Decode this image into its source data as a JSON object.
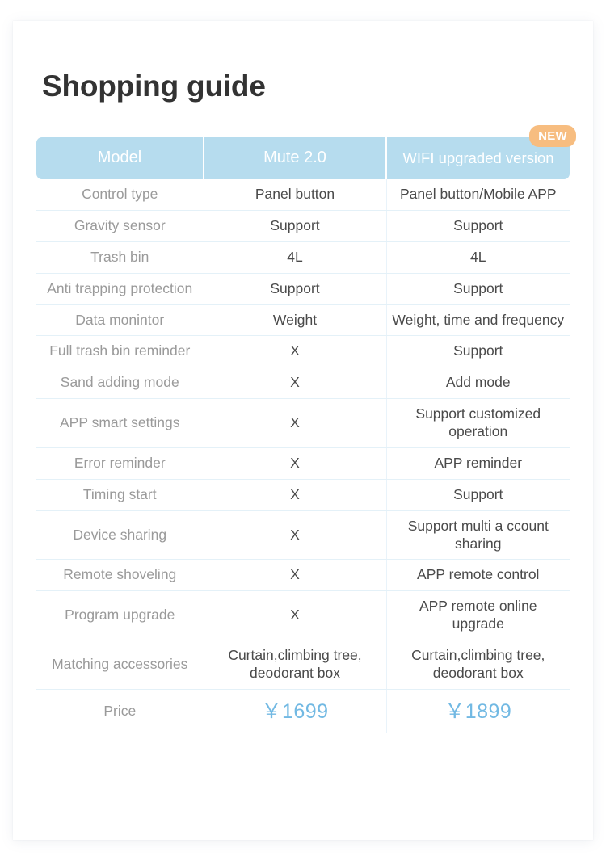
{
  "page": {
    "title": "Shopping guide"
  },
  "badge": {
    "new_label": "NEW"
  },
  "colors": {
    "header_bg": "#b6dcee",
    "header_text": "#ffffff",
    "badge_bg": "#f7bd80",
    "row_label": "#9a9a9a",
    "cell_text": "#4a4a4a",
    "price_accent": "#72b9e3",
    "row_divider": "#e4f1f8",
    "card_bg": "#ffffff"
  },
  "table": {
    "columns": [
      {
        "key": "model",
        "label": "Model"
      },
      {
        "key": "mute",
        "label": "Mute 2.0"
      },
      {
        "key": "wifi",
        "label": "WIFI upgraded version"
      }
    ],
    "rows": [
      {
        "label": "Control type",
        "mute": "Panel button",
        "wifi": "Panel button/Mobile APP"
      },
      {
        "label": "Gravity sensor",
        "mute": "Support",
        "wifi": "Support"
      },
      {
        "label": "Trash bin",
        "mute": "4L",
        "wifi": "4L"
      },
      {
        "label": "Anti trapping protection",
        "mute": "Support",
        "wifi": "Support"
      },
      {
        "label": "Data monintor",
        "mute": "Weight",
        "wifi": "Weight, time and frequency"
      },
      {
        "label": "Full trash bin reminder",
        "mute": "X",
        "wifi": "Support"
      },
      {
        "label": "Sand adding mode",
        "mute": "X",
        "wifi": "Add mode"
      },
      {
        "label": "APP smart settings",
        "mute": "X",
        "wifi": "Support customized operation"
      },
      {
        "label": "Error reminder",
        "mute": "X",
        "wifi": "APP reminder"
      },
      {
        "label": "Timing start",
        "mute": "X",
        "wifi": "Support"
      },
      {
        "label": "Device sharing",
        "mute": "X",
        "wifi": "Support multi a ccount sharing"
      },
      {
        "label": "Remote shoveling",
        "mute": "X",
        "wifi": "APP remote control"
      },
      {
        "label": "Program upgrade",
        "mute": "X",
        "wifi": "APP remote online upgrade"
      },
      {
        "label": "Matching accessories",
        "mute": "Curtain,climbing tree, deodorant box",
        "wifi": "Curtain,climbing tree, deodorant box"
      },
      {
        "label": "Price",
        "mute": "￥1699",
        "wifi": "￥1899"
      }
    ]
  }
}
